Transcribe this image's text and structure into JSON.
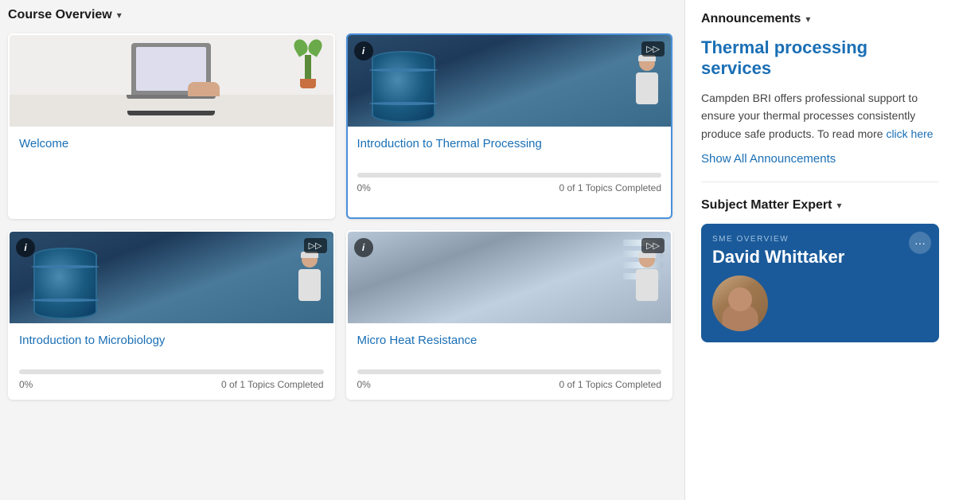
{
  "main": {
    "section_header": "Course Overview",
    "section_header_icon": "▾",
    "cards": [
      {
        "id": "welcome",
        "title": "Welcome",
        "image_type": "laptop",
        "has_info": false,
        "has_play": false,
        "has_progress": false,
        "progress_pct": 0,
        "progress_label": "",
        "topics_label": "",
        "active": false
      },
      {
        "id": "thermal-processing",
        "title": "Introduction to Thermal Processing",
        "image_type": "industrial",
        "has_info": true,
        "has_play": true,
        "has_progress": true,
        "progress_pct": 0,
        "progress_label": "0%",
        "topics_label": "0 of 1 Topics Completed",
        "active": true
      },
      {
        "id": "microbiology",
        "title": "Introduction to Microbiology",
        "image_type": "industrial",
        "has_info": true,
        "has_play": true,
        "has_progress": true,
        "progress_pct": 0,
        "progress_label": "0%",
        "topics_label": "0 of 1 Topics Completed",
        "active": false
      },
      {
        "id": "micro-heat",
        "title": "Micro Heat Resistance",
        "image_type": "industrial2",
        "has_info": true,
        "has_play": true,
        "has_progress": true,
        "progress_pct": 0,
        "progress_label": "0%",
        "topics_label": "0 of 1 Topics Completed",
        "active": false
      }
    ]
  },
  "right": {
    "announcements_header": "Announcements",
    "announcements_icon": "▾",
    "announcement_title": "Thermal processing services",
    "announcement_body_1": "Campden BRI offers professional support to ensure your thermal processes consistently produce safe products. To read more",
    "announcement_link_text": "click here",
    "show_all_label": "Show All Announcements",
    "sme_header": "Subject Matter Expert",
    "sme_icon": "▾",
    "sme_card": {
      "label": "SME OVERVIEW",
      "name": "David Whittaker",
      "menu_icon": "···"
    }
  }
}
